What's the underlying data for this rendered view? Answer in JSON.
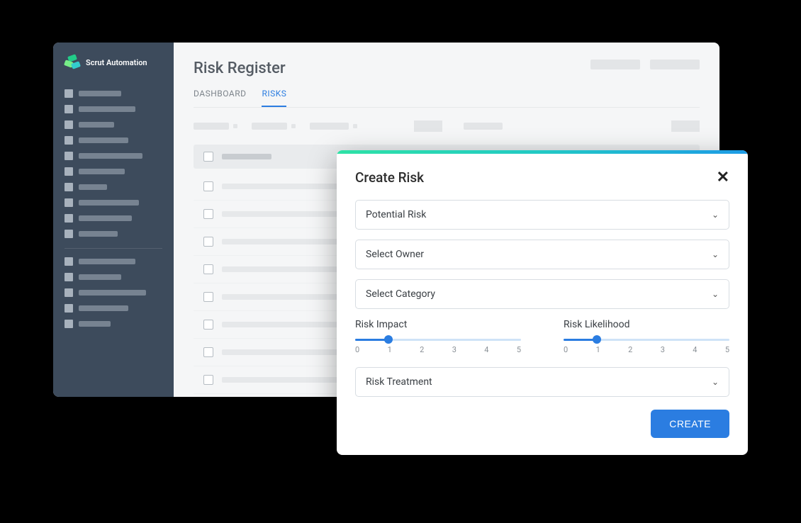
{
  "brand": {
    "name": "Scrut Automation"
  },
  "sidebar": {
    "group1_widths": [
      60,
      80,
      50,
      70,
      90,
      65,
      40,
      85,
      75,
      55
    ],
    "group2_widths": [
      80,
      60,
      95,
      70,
      45
    ]
  },
  "header": {
    "title": "Risk Register",
    "pill_widths": [
      70,
      70
    ]
  },
  "tabs": [
    {
      "label": "DASHBOARD",
      "active": false
    },
    {
      "label": "RISKS",
      "active": true
    }
  ],
  "filters": {
    "chunks": [
      {
        "bar": 50,
        "dot": true
      },
      {
        "bar": 50,
        "dot": true
      },
      {
        "bar": 55,
        "dot": true
      }
    ],
    "solid_width": 40,
    "solo_bar_width": 55,
    "right_solid_width": 40
  },
  "list": {
    "rows": 8
  },
  "modal": {
    "title": "Create Risk",
    "fields": {
      "potential_risk": "Potential Risk",
      "select_owner": "Select Owner",
      "select_category": "Select Category",
      "risk_treatment": "Risk Treatment"
    },
    "sliders": {
      "impact": {
        "label": "Risk Impact",
        "min": 0,
        "max": 5,
        "value": 1
      },
      "likelihood": {
        "label": "Risk Likelihood",
        "min": 0,
        "max": 5,
        "value": 1
      }
    },
    "create_button": "CREATE"
  }
}
